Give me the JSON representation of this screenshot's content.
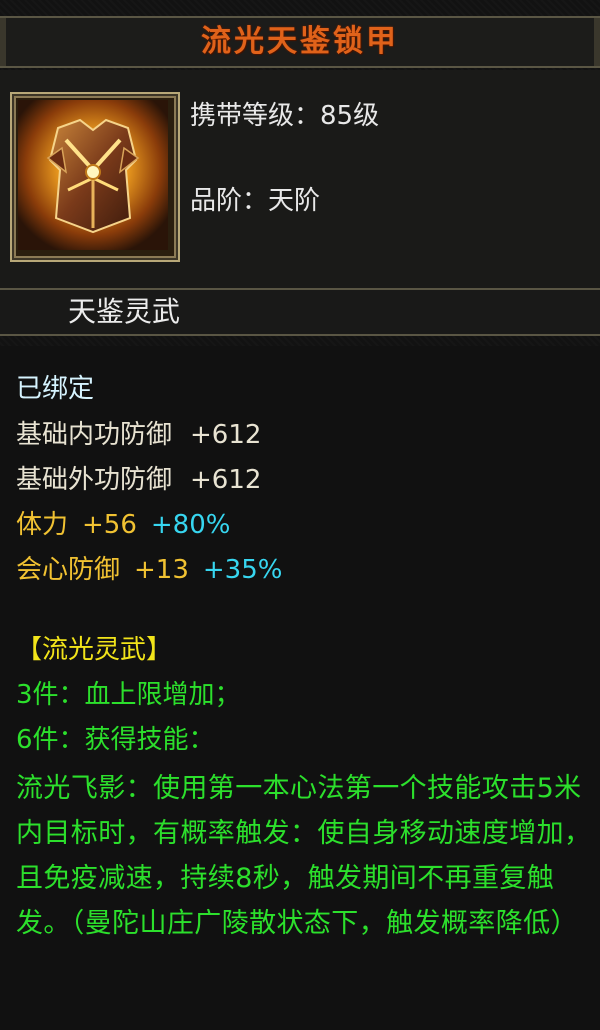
{
  "item": {
    "name": "流光天鉴锁甲",
    "level_label": "携带等级：85级",
    "grade_label": "品阶：天阶",
    "set_title": "天鉴灵武",
    "bound": "已绑定",
    "icon": "armor-icon"
  },
  "stats": [
    {
      "label": "基础内功防御",
      "value": "+612"
    },
    {
      "label": "基础外功防御",
      "value": "+612"
    }
  ],
  "bonus_stats": [
    {
      "label": "体力",
      "value": "+56",
      "percent": "+80%"
    },
    {
      "label": "会心防御",
      "value": "+13",
      "percent": "+35%"
    }
  ],
  "set_bonus": {
    "name": "【流光灵武】",
    "piece3": "3件：血上限增加；",
    "piece6": "6件：获得技能：",
    "skill_desc": "流光飞影：使用第一本心法第一个技能攻击5米内目标时，有概率触发：使自身移动速度增加，且免疫减速，持续8秒，触发期间不再重复触发。（曼陀山庄广陵散状态下，触发概率降低）"
  },
  "colors": {
    "title": "#e0621a",
    "gold": "#f1c232",
    "cyan": "#37d6f0",
    "green": "#2ce02c",
    "set_name": "#f2e41a"
  }
}
